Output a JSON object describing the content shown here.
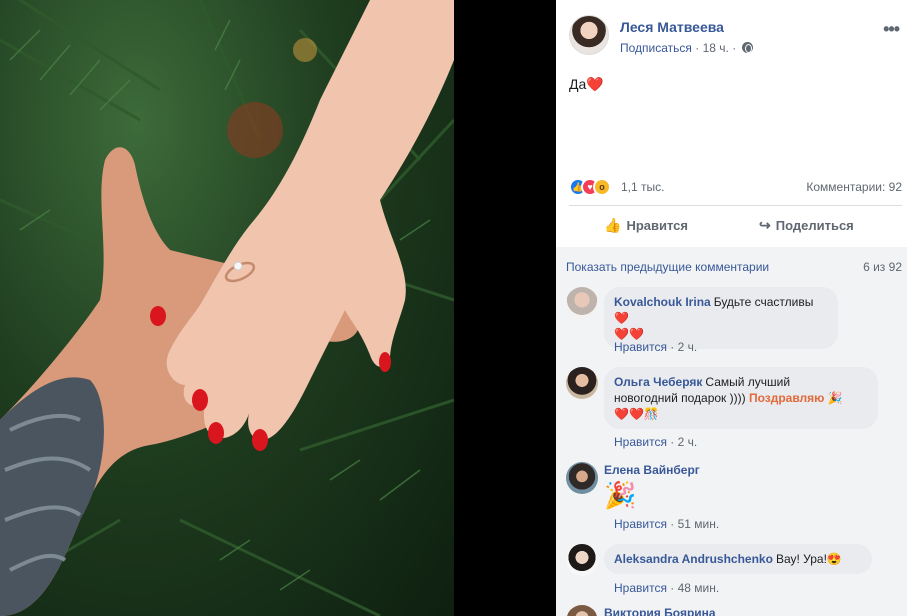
{
  "post": {
    "author": "Леся Матвеева",
    "subscribe": "Подписаться",
    "time": "18 ч.",
    "text": "Да",
    "text_emoji": "❤️"
  },
  "stats": {
    "reactions_count": "1,1 тыс.",
    "comments": "Комментарии: 92"
  },
  "actions": {
    "like": "Нравится",
    "share": "Поделиться"
  },
  "comments_header": {
    "prev": "Показать предыдущие комментарии",
    "counter": "6 из 92"
  },
  "comments": [
    {
      "name": "Kovalchouk Irina",
      "text": "Будьте счастливы ❤️",
      "text2": "❤️❤️",
      "like": "Нравится",
      "time": "2 ч."
    },
    {
      "name": "Ольга Чеберяк",
      "text": "Самый лучший",
      "text2": "новогодний подарок ))))",
      "tag": "Поздравляю",
      "text3": "❤️❤️🎊",
      "like": "Нравится",
      "time": "2 ч."
    },
    {
      "name": "Елена Вайнберг",
      "sticker": "🎉",
      "like": "Нравится",
      "time": "51 мин."
    },
    {
      "name": "Aleksandra Andrushchenko",
      "text": "Вау! Ура!😍",
      "like": "Нравится",
      "time": "48 мин."
    },
    {
      "name": "Виктория Боярина"
    }
  ],
  "colors": {
    "link": "#385898",
    "meta": "#606770",
    "bubble": "#e9ebee",
    "nail": "#d9161e"
  }
}
